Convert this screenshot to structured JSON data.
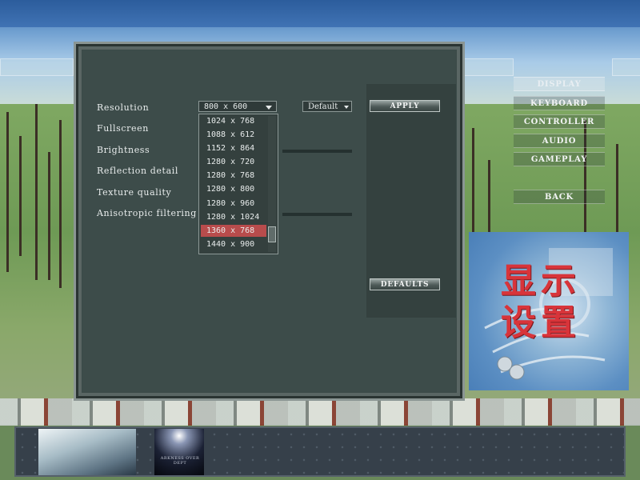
{
  "settings": {
    "labels": {
      "resolution": "Resolution",
      "fullscreen": "Fullscreen",
      "brightness": "Brightness",
      "reflection": "Reflection detail",
      "texture": "Texture quality",
      "anisotropic": "Anisotropic filtering"
    },
    "resolution_value": "800 x 600",
    "aspect_value": "Default",
    "resolution_options": [
      "1024 x 768",
      "1088 x 612",
      "1152 x 864",
      "1280 x 720",
      "1280 x 768",
      "1280 x 800",
      "1280 x 960",
      "1280 x 1024",
      "1360 x 768",
      "1440 x 900"
    ],
    "selected_option": "1360 x 768",
    "apply_label": "APPLY",
    "defaults_label": "DEFAULTS"
  },
  "menu": {
    "display": "DISPLAY",
    "keyboard": "KEYBOARD",
    "controller": "CONTROLLER",
    "audio": "AUDIO",
    "gameplay": "GAMEPLAY",
    "back": "BACK"
  },
  "picture": {
    "line1": "显示",
    "line2": "设置"
  },
  "bottom": {
    "thumb2_caption": "ARKNESS OVER DEPT"
  },
  "colors": {
    "selected_item": "#b84c4c",
    "panel": "#3d4c4a",
    "picture_text": "#d8343a"
  }
}
